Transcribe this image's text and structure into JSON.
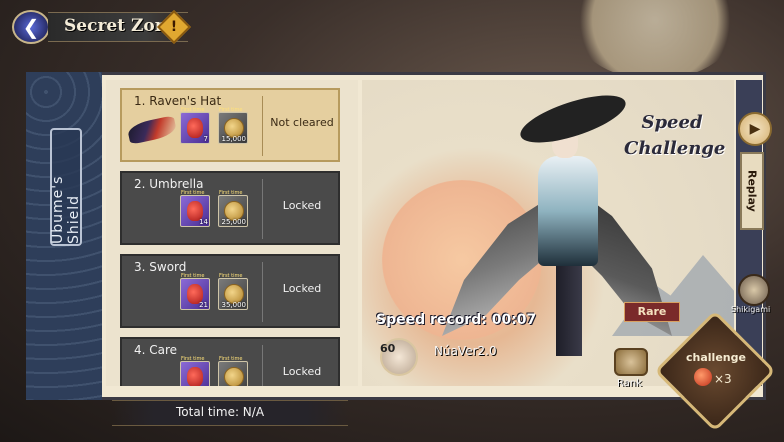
{
  "header": {
    "title": "Secret Zone",
    "warning_icon": "!"
  },
  "side_label": "Ubume's Shield",
  "stages": [
    {
      "title": "1. Raven's Hat",
      "status": "Not cleared",
      "rewards": [
        {
          "tag": "First time",
          "qty": "7",
          "icon": "red-bead-icon"
        },
        {
          "tag": "First time",
          "qty": "15,000",
          "icon": "gold-coin-icon"
        }
      ]
    },
    {
      "title": "2. Umbrella",
      "status": "Locked",
      "rewards": [
        {
          "tag": "First time",
          "qty": "14",
          "icon": "red-bead-icon"
        },
        {
          "tag": "First time",
          "qty": "25,000",
          "icon": "gold-coin-icon"
        }
      ]
    },
    {
      "title": "3. Sword",
      "status": "Locked",
      "rewards": [
        {
          "tag": "First time",
          "qty": "21",
          "icon": "red-bead-icon"
        },
        {
          "tag": "First time",
          "qty": "35,000",
          "icon": "gold-coin-icon"
        }
      ]
    },
    {
      "title": "4. Care",
      "status": "Locked",
      "rewards": [
        {
          "tag": "First time",
          "qty": "",
          "icon": "red-bead-icon"
        },
        {
          "tag": "First time",
          "qty": "",
          "icon": "gold-coin-icon"
        }
      ]
    }
  ],
  "art": {
    "speed_challenge_line1": "Speed",
    "speed_challenge_line2": "Challenge",
    "speed_record": "Speed record: 00:07",
    "rarity": "Rare",
    "player_level": "60",
    "player_name": "NúaVer2.0"
  },
  "controls": {
    "replay": "Replay",
    "shikigami": "Shikigami",
    "rank": "Rank",
    "challenge": "challenge",
    "ticket_count": "×3"
  },
  "footer": {
    "total_time": "Total time: N/A"
  }
}
